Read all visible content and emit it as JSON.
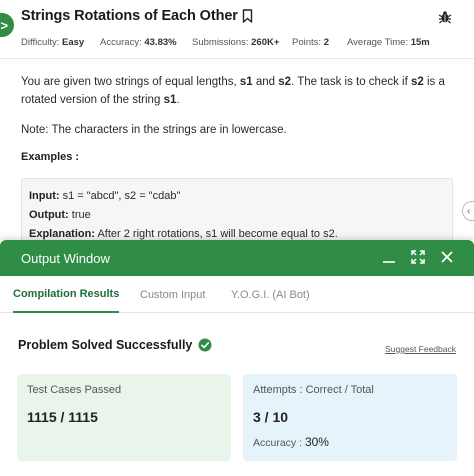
{
  "problem": {
    "title": "Strings Rotations of Each Other",
    "meta": {
      "difficulty_label": "Difficulty:",
      "difficulty_value": "Easy",
      "accuracy_label": "Accuracy:",
      "accuracy_value": "43.83%",
      "submissions_label": "Submissions:",
      "submissions_value": "260K+",
      "points_label": "Points:",
      "points_value": "2",
      "avg_time_label": "Average Time:",
      "avg_time_value": "15m"
    },
    "description": {
      "part1": "You are given two strings of equal lengths, ",
      "s1": "s1",
      "part2": " and ",
      "s2": "s2",
      "part3": ". The task is to check if ",
      "s2b": "s2",
      "part4": " is a rotated version of the string ",
      "s1b": "s1",
      "part5": "."
    },
    "note": "Note: The characters in the strings are in lowercase.",
    "examples_heading": "Examples :",
    "example": {
      "input_label": "Input:",
      "input_value": " s1 = \"abcd\", s2 = \"cdab\"",
      "output_label": "Output:",
      "output_value": " true",
      "explanation_label": "Explanation:",
      "explanation_value": " After 2 right rotations, s1 will become equal to s2."
    }
  },
  "output_window": {
    "title": "Output Window",
    "tabs": [
      {
        "label": "Compilation Results",
        "active": true
      },
      {
        "label": "Custom Input",
        "active": false
      },
      {
        "label": "Y.O.G.I. (AI Bot)",
        "active": false
      }
    ],
    "status": "Problem Solved Successfully",
    "suggest_feedback": "Suggest Feedback",
    "test_cases_label": "Test Cases Passed",
    "test_cases_value": "1115 / 1115",
    "attempts_label": "Attempts : Correct / Total",
    "attempts_value": "3 / 10",
    "accuracy_label": "Accuracy : ",
    "accuracy_value": "30%"
  },
  "colors": {
    "brand_green": "#2f8d46",
    "success_card": "#e9f4eb",
    "info_card": "#e7f3fb"
  },
  "icons": [
    "arrow-right-icon",
    "bookmark-icon",
    "bug-icon",
    "minimize-icon",
    "expand-icon",
    "close-icon",
    "check-circle-icon",
    "collapse-arrow-icon"
  ]
}
